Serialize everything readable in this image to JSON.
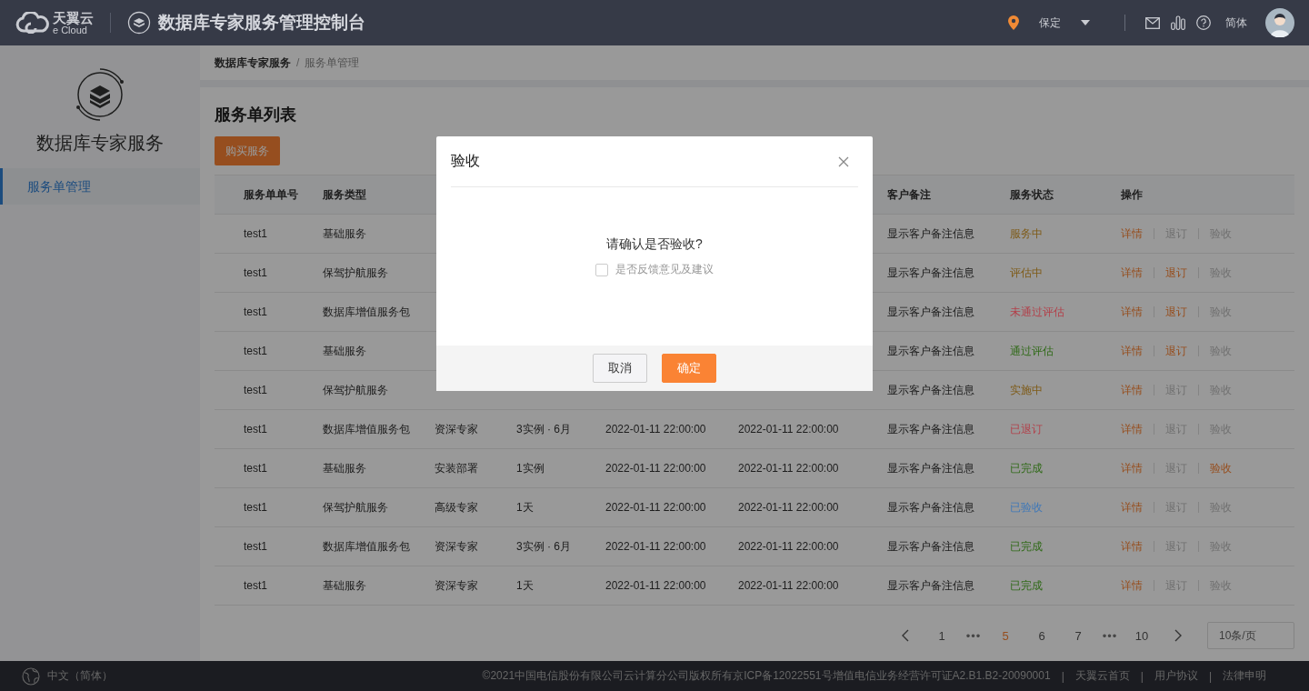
{
  "header": {
    "brand": {
      "name": "天翼云",
      "sub": "e Cloud"
    },
    "title": "数据库专家服务管理控制台",
    "location": "保定",
    "language": "简体"
  },
  "sidebar": {
    "title": "数据库专家服务",
    "items": [
      {
        "label": "服务单管理",
        "selected": true
      }
    ]
  },
  "breadcrumb": {
    "items": [
      "数据库专家服务",
      "服务单管理"
    ],
    "separator": "/"
  },
  "page_title": "服务单列表",
  "buy_button": "购买服务",
  "table": {
    "columns": [
      "服务单单号",
      "服务类型",
      null,
      null,
      null,
      null,
      "客户备注",
      "服务状态",
      "操作"
    ],
    "rows": [
      {
        "cells": [
          "test1",
          "基础服务",
          null,
          null,
          null,
          null,
          "显示客户备注信息"
        ],
        "status": {
          "text": "服务中",
          "color": "#7e5a16"
        },
        "actions": [
          {
            "label": "详情",
            "disabled": false
          },
          {
            "label": "退订",
            "disabled": true
          },
          {
            "label": "验收",
            "disabled": true
          }
        ]
      },
      {
        "cells": [
          "test1",
          "保驾护航服务",
          null,
          null,
          null,
          null,
          "显示客户备注信息"
        ],
        "status": {
          "text": "评估中",
          "color": "#7e5a16"
        },
        "actions": [
          {
            "label": "详情",
            "disabled": false
          },
          {
            "label": "退订",
            "disabled": false
          },
          {
            "label": "验收",
            "disabled": true
          }
        ]
      },
      {
        "cells": [
          "test1",
          "数据库增值服务包",
          null,
          null,
          null,
          null,
          "显示客户备注信息"
        ],
        "status": {
          "text": "未通过评估",
          "color": "#b2404a"
        },
        "actions": [
          {
            "label": "详情",
            "disabled": false
          },
          {
            "label": "退订",
            "disabled": false
          },
          {
            "label": "验收",
            "disabled": true
          }
        ]
      },
      {
        "cells": [
          "test1",
          "基础服务",
          null,
          null,
          null,
          null,
          "显示客户备注信息"
        ],
        "status": {
          "text": "通过评估",
          "color": "#306a18"
        },
        "actions": [
          {
            "label": "详情",
            "disabled": false
          },
          {
            "label": "退订",
            "disabled": false
          },
          {
            "label": "验收",
            "disabled": true
          }
        ]
      },
      {
        "cells": [
          "test1",
          "保驾护航服务",
          null,
          null,
          null,
          null,
          "显示客户备注信息"
        ],
        "status": {
          "text": "实施中",
          "color": "#7e5a16"
        },
        "actions": [
          {
            "label": "详情",
            "disabled": false
          },
          {
            "label": "退订",
            "disabled": true
          },
          {
            "label": "验收",
            "disabled": true
          }
        ]
      },
      {
        "cells": [
          "test1",
          "数据库增值服务包",
          "资深专家",
          "3实例 · 6月",
          "2022-01-11 22:00:00",
          "2022-01-11 22:00:00",
          "显示客户备注信息"
        ],
        "status": {
          "text": "已退订",
          "color": "#b2404a"
        },
        "actions": [
          {
            "label": "详情",
            "disabled": false
          },
          {
            "label": "退订",
            "disabled": true
          },
          {
            "label": "验收",
            "disabled": true
          }
        ]
      },
      {
        "cells": [
          "test1",
          "基础服务",
          "安装部署",
          "1实例",
          "2022-01-11 22:00:00",
          "2022-01-11 22:00:00",
          "显示客户备注信息"
        ],
        "status": {
          "text": "已完成",
          "color": "#306a18"
        },
        "actions": [
          {
            "label": "详情",
            "disabled": false
          },
          {
            "label": "退订",
            "disabled": true
          },
          {
            "label": "验收",
            "disabled": false
          }
        ]
      },
      {
        "cells": [
          "test1",
          "保驾护航服务",
          "高级专家",
          "1天",
          "2022-01-11 22:00:00",
          "2022-01-11 22:00:00",
          "显示客户备注信息"
        ],
        "status": {
          "text": "已验收",
          "color": "#3f78b8"
        },
        "actions": [
          {
            "label": "详情",
            "disabled": false
          },
          {
            "label": "退订",
            "disabled": true
          },
          {
            "label": "验收",
            "disabled": true
          }
        ]
      },
      {
        "cells": [
          "test1",
          "数据库增值服务包",
          "资深专家",
          "3实例 · 6月",
          "2022-01-11 22:00:00",
          "2022-01-11 22:00:00",
          "显示客户备注信息"
        ],
        "status": {
          "text": "已完成",
          "color": "#306a18"
        },
        "actions": [
          {
            "label": "详情",
            "disabled": false
          },
          {
            "label": "退订",
            "disabled": true
          },
          {
            "label": "验收",
            "disabled": true
          }
        ]
      },
      {
        "cells": [
          "test1",
          "基础服务",
          "资深专家",
          "1天",
          "2022-01-11 22:00:00",
          "2022-01-11 22:00:00",
          "显示客户备注信息"
        ],
        "status": {
          "text": "已完成",
          "color": "#306a18"
        },
        "actions": [
          {
            "label": "详情",
            "disabled": false
          },
          {
            "label": "退订",
            "disabled": true
          },
          {
            "label": "验收",
            "disabled": true
          }
        ]
      }
    ]
  },
  "pagination": {
    "pages": [
      {
        "kind": "page",
        "label": "1",
        "selected": false
      },
      {
        "kind": "ellipsis",
        "label": "•••"
      },
      {
        "kind": "page",
        "label": "5",
        "selected": true
      },
      {
        "kind": "page",
        "label": "6",
        "selected": false
      },
      {
        "kind": "page",
        "label": "7",
        "selected": false
      },
      {
        "kind": "ellipsis",
        "label": "•••"
      },
      {
        "kind": "page",
        "label": "10",
        "selected": false
      }
    ],
    "page_size": "10条/页"
  },
  "footer": {
    "language": "中文（简体）",
    "copyright": "©2021中国电信股份有限公司云计算分公司版权所有京ICP备12022551号增值电信业务经营许可证A2.B1.B2-20090001",
    "links": [
      "天翼云首页",
      "用户协议",
      "法律申明"
    ],
    "separator": "|"
  },
  "dialog": {
    "title": "验收",
    "message": "请确认是否验收?",
    "checkbox": {
      "label": "是否反馈意见及建议",
      "checked": false
    },
    "buttons": [
      {
        "label": "取消",
        "kind": "default"
      },
      {
        "label": "确定",
        "kind": "primary"
      }
    ]
  }
}
